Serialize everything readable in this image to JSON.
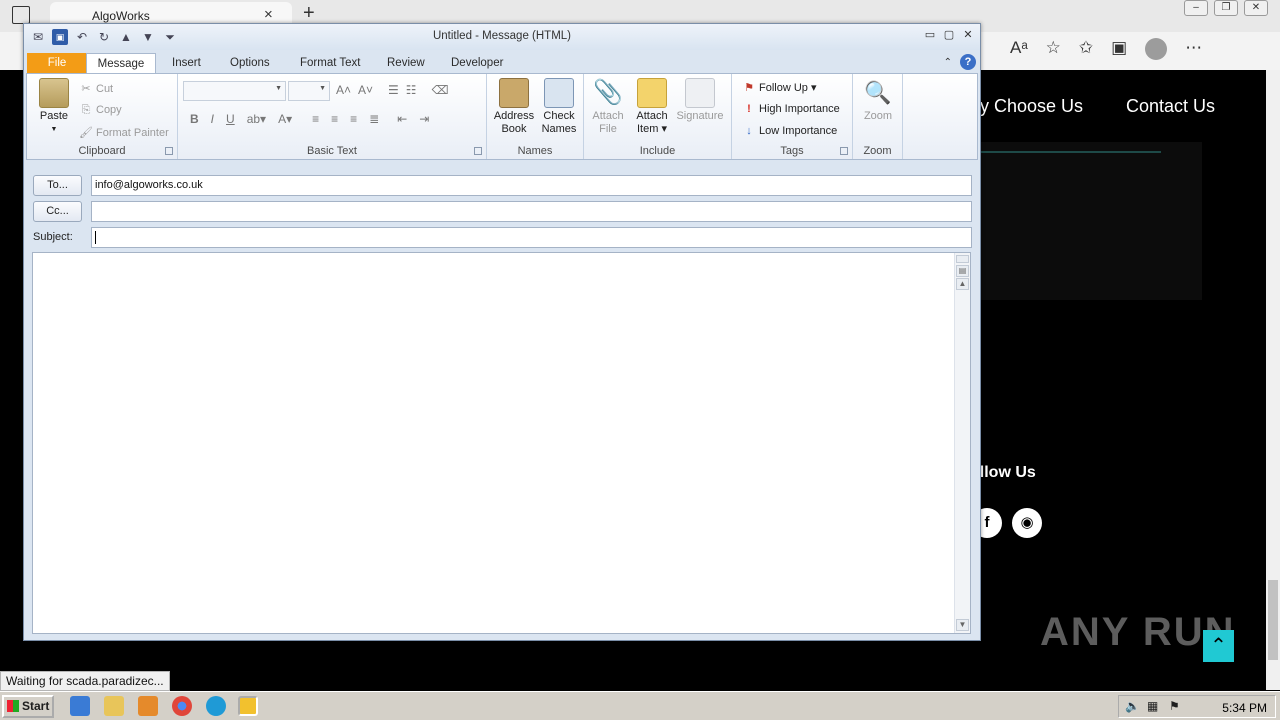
{
  "browser": {
    "tab_title": "AlgoWorks",
    "tab_close": "×",
    "new_tab": "+",
    "win_buttons": [
      "–",
      "❐",
      "✕"
    ],
    "toolbar_icons": [
      "read-aloud-icon",
      "add-favorite-icon",
      "favorites-icon",
      "collections-icon",
      "profile-icon",
      "more-icon"
    ],
    "status_text": "Waiting for scada.paradizec..."
  },
  "website": {
    "nav_why": "ny Choose Us",
    "nav_contact": "Contact Us",
    "follow_us": "ollow Us",
    "social_fb": "f",
    "social_discord": "◉",
    "watermark": "ANY RUN",
    "accent": "#20c9d3"
  },
  "taskbar": {
    "start_label": "Start",
    "clock": "5:34 PM"
  },
  "outlook": {
    "window_title": "Untitled  -  Message (HTML)",
    "tabs": {
      "file": "File",
      "message": "Message",
      "insert": "Insert",
      "options": "Options",
      "format_text": "Format Text",
      "review": "Review",
      "developer": "Developer"
    },
    "clipboard": {
      "label": "Clipboard",
      "paste": "Paste",
      "cut": "Cut",
      "copy": "Copy",
      "format_painter": "Format Painter"
    },
    "basic_text": {
      "label": "Basic Text",
      "bold": "B",
      "italic": "I",
      "underline": "U"
    },
    "names": {
      "label": "Names",
      "address_book_1": "Address",
      "address_book_2": "Book",
      "check_names_1": "Check",
      "check_names_2": "Names"
    },
    "include": {
      "label": "Include",
      "attach_file_1": "Attach",
      "attach_file_2": "File",
      "attach_item_1": "Attach",
      "attach_item_2": "Item ▾",
      "signature": "Signature"
    },
    "tags": {
      "label": "Tags",
      "follow_up": "Follow Up ▾",
      "high": "High Importance",
      "low": "Low Importance"
    },
    "zoom": {
      "label": "Zoom",
      "button": "Zoom"
    },
    "fields": {
      "to_btn": "To...",
      "to_value": "info@algoworks.co.uk",
      "cc_btn": "Cc...",
      "cc_value": "",
      "subject_label": "Subject:",
      "subject_value": ""
    }
  }
}
